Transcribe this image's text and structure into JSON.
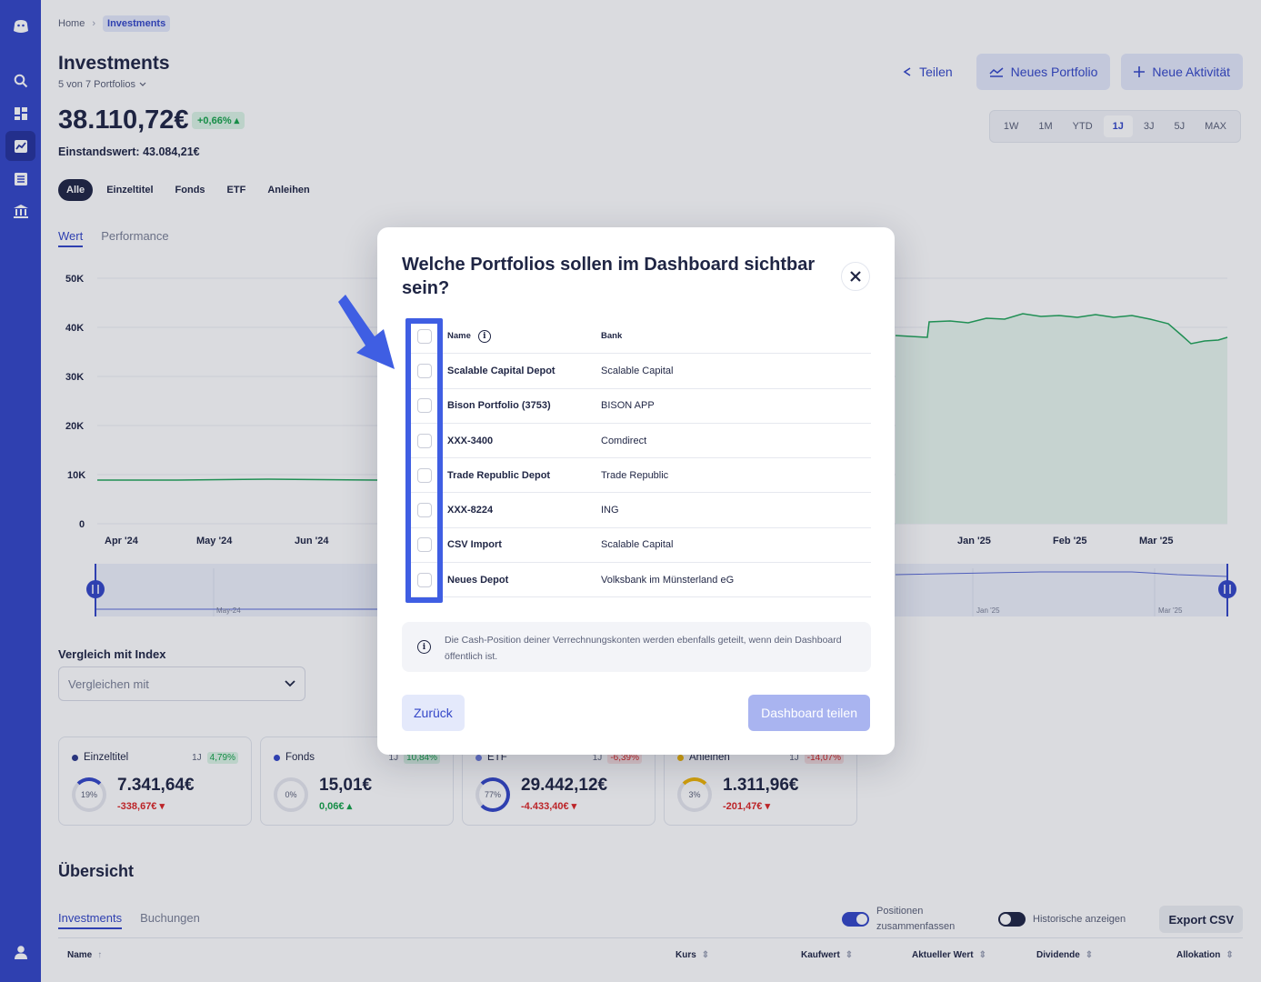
{
  "breadcrumb": {
    "home": "Home",
    "current": "Investments"
  },
  "page": {
    "title": "Investments",
    "portfolio_selector": "5 von 7 Portfolios",
    "total_value": "38.110,72€",
    "change": "+0,66%",
    "cost_basis": "Einstandswert: 43.084,21€"
  },
  "actions": {
    "share": "Teilen",
    "new_portfolio": "Neues Portfolio",
    "new_activity": "Neue Aktivität"
  },
  "filters": [
    "Alle",
    "Einzeltitel",
    "Fonds",
    "ETF",
    "Anleihen"
  ],
  "ranges": [
    "1W",
    "1M",
    "YTD",
    "1J",
    "3J",
    "5J",
    "MAX"
  ],
  "chart_tabs": {
    "value": "Wert",
    "performance": "Performance"
  },
  "chart_data": {
    "type": "area",
    "y_ticks": [
      "50K",
      "40K",
      "30K",
      "20K",
      "10K",
      "0"
    ],
    "x_ticks": [
      "Apr '24",
      "May '24",
      "Jun '24",
      "Jan '25",
      "Feb '25",
      "Mar '25"
    ],
    "navigator_ticks": [
      "May-24",
      "Jan '25",
      "Mar '25"
    ],
    "series_color": "#22a55a"
  },
  "compare": {
    "label": "Vergleich mit Index",
    "placeholder": "Vergleichen mit"
  },
  "cards": [
    {
      "name": "Einzeltitel",
      "period": "1J",
      "pct": "4,79%",
      "alloc": "19%",
      "value": "7.341,64€",
      "delta": "-338,67€",
      "dot": "#2d3a8c"
    },
    {
      "name": "Fonds",
      "period": "1J",
      "pct": "10,84%",
      "alloc": "0%",
      "value": "15,01€",
      "delta": "0,06€",
      "dot": "#3447c8"
    },
    {
      "name": "ETF",
      "period": "1J",
      "pct": "-6,39%",
      "alloc": "77%",
      "value": "29.442,12€",
      "delta": "-4.433,40€",
      "dot": "#6f7fe0"
    },
    {
      "name": "Anleihen",
      "period": "1J",
      "pct": "-14,07%",
      "alloc": "3%",
      "value": "1.311,96€",
      "delta": "-201,47€",
      "dot": "#f2b705"
    }
  ],
  "overview": {
    "title": "Übersicht",
    "tab_investments": "Investments",
    "tab_bookings": "Buchungen",
    "toggle_merge": "Positionen zusammenfassen",
    "toggle_history": "Historische anzeigen",
    "export": "Export CSV",
    "columns": [
      "Name",
      "Kurs",
      "Kaufwert",
      "Aktueller Wert",
      "Dividende",
      "Allokation"
    ]
  },
  "modal": {
    "title": "Welche Portfolios sollen im Dashboard sichtbar sein?",
    "col_name": "Name",
    "col_bank": "Bank",
    "rows": [
      {
        "name": "Scalable Capital Depot",
        "bank": "Scalable Capital"
      },
      {
        "name": "Bison Portfolio (3753)",
        "bank": "BISON APP"
      },
      {
        "name": "XXX-3400",
        "bank": "Comdirect"
      },
      {
        "name": "Trade Republic Depot",
        "bank": "Trade Republic"
      },
      {
        "name": "XXX-8224",
        "bank": "ING"
      },
      {
        "name": "CSV Import",
        "bank": "Scalable Capital"
      },
      {
        "name": "Neues Depot",
        "bank": "Volksbank im Münsterland eG"
      }
    ],
    "notice": "Die Cash-Position deiner Verrechnungskonten werden ebenfalls geteilt, wenn dein Dashboard öffentlich ist.",
    "back": "Zurück",
    "share": "Dashboard teilen"
  }
}
